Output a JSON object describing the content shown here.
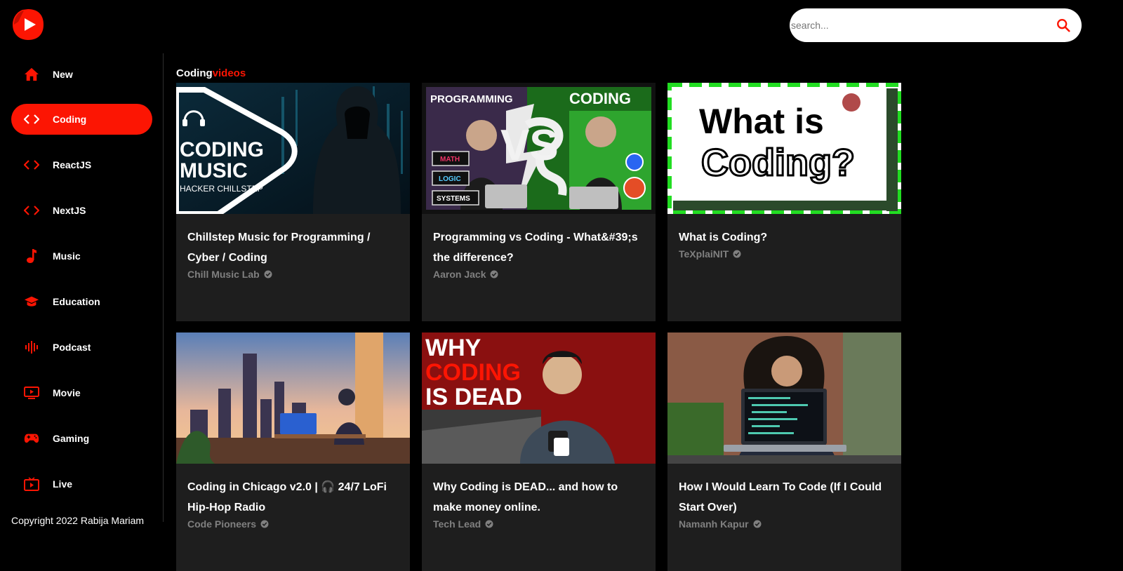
{
  "brand": {
    "logo_icon": "youtube-play-icon",
    "accent_color": "#FC1503"
  },
  "search": {
    "placeholder": "search...",
    "icon": "search-icon"
  },
  "sidebar": {
    "items": [
      {
        "label": "New",
        "icon": "home-icon",
        "active": false
      },
      {
        "label": "Coding",
        "icon": "code-icon",
        "active": true
      },
      {
        "label": "ReactJS",
        "icon": "code-icon",
        "active": false
      },
      {
        "label": "NextJS",
        "icon": "code-icon",
        "active": false
      },
      {
        "label": "Music",
        "icon": "music-note-icon",
        "active": false
      },
      {
        "label": "Education",
        "icon": "graduation-cap-icon",
        "active": false
      },
      {
        "label": "Podcast",
        "icon": "podcast-icon",
        "active": false
      },
      {
        "label": "Movie",
        "icon": "movie-icon",
        "active": false
      },
      {
        "label": "Gaming",
        "icon": "gamepad-icon",
        "active": false
      },
      {
        "label": "Live",
        "icon": "live-tv-icon",
        "active": false
      }
    ],
    "copyright": "Copyright 2022 Rabija Mariam"
  },
  "main": {
    "heading_word1": "Coding",
    "heading_word2": "videos",
    "videos": [
      {
        "title": "Chillstep Music for Programming / Cyber / Coding",
        "channel": "Chill Music Lab",
        "thumb_lines": [
          "CODING",
          "MUSIC",
          "HACKER CHILLSTEP"
        ]
      },
      {
        "title": "Programming vs Coding - What&#39;s the difference?",
        "channel": "Aaron Jack",
        "thumb_lines": [
          "PROGRAMMING",
          "CODING",
          "VS",
          "MATH",
          "LOGIC",
          "SYSTEMS"
        ]
      },
      {
        "title": "What is Coding?",
        "channel": "TeXplaiNIT",
        "thumb_lines": [
          "What is",
          "Coding?"
        ]
      },
      {
        "title": "Coding in Chicago v2.0 | 🎧 24/7 LoFi Hip-Hop Radio",
        "channel": "Code Pioneers",
        "thumb_lines": []
      },
      {
        "title": "Why Coding is DEAD... and how to make money online.",
        "channel": "Tech Lead",
        "thumb_lines": [
          "WHY",
          "CODING",
          "IS DEAD"
        ]
      },
      {
        "title": "How I Would Learn To Code (If I Could Start Over)",
        "channel": "Namanh Kapur",
        "thumb_lines": []
      }
    ]
  }
}
